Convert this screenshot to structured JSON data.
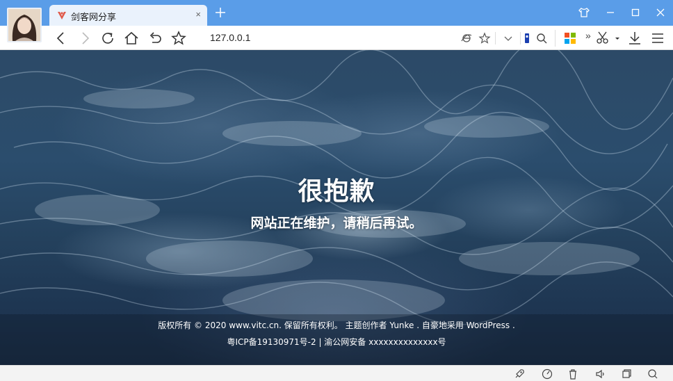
{
  "browser": {
    "tab": {
      "title": "剑客网分享",
      "close": "×"
    },
    "new_tab": "+",
    "address": {
      "url": "127.0.0.1"
    },
    "toolbar_more": "»",
    "icons": {
      "back": "back-arrow-icon",
      "forward": "forward-arrow-icon",
      "refresh": "refresh-icon",
      "home": "home-icon",
      "undo": "undo-close-tab-icon",
      "favorite": "star-icon",
      "skin": "tshirt-skin-icon",
      "minimize": "minimize-icon",
      "maximize": "maximize-icon",
      "close": "close-icon",
      "ie_mode": "ie-compat-icon",
      "fav_page": "star-icon",
      "dropdown": "chevron-down-icon",
      "search_engine": "search-icon",
      "apps": "apps-grid-icon",
      "scissors": "screenshot-scissors-icon",
      "download": "download-icon",
      "menu": "menu-icon"
    },
    "accent_color": "#5a9de8"
  },
  "page": {
    "headline": "很抱歉",
    "subline": "网站正在维护，请稍后再试。",
    "footer": {
      "line1": "版权所有 © 2020 www.vitc.cn. 保留所有权利。 主题创作者 Yunke . 自豪地采用 WordPress .",
      "line2": "粤ICP备19130971号-2 | 渝公网安备 xxxxxxxxxxxxxx号"
    }
  },
  "statusbar": {
    "icons": [
      "rocket-icon",
      "speed-gauge-icon",
      "trash-icon",
      "speaker-icon",
      "window-restore-icon",
      "zoom-search-icon"
    ]
  }
}
